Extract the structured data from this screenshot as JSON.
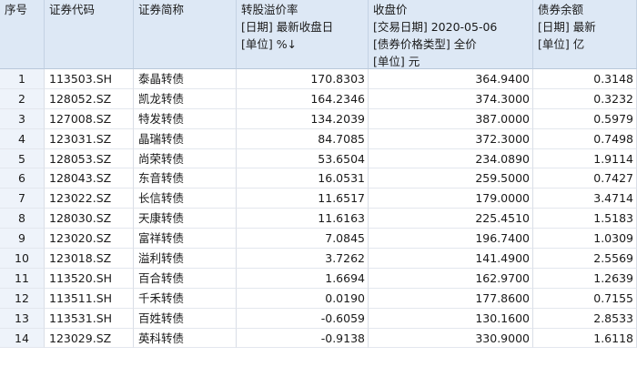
{
  "headers": [
    {
      "key": "idx",
      "lines": [
        "序号"
      ]
    },
    {
      "key": "code",
      "lines": [
        "证券代码"
      ]
    },
    {
      "key": "name",
      "lines": [
        "证券简称"
      ]
    },
    {
      "key": "premium",
      "lines": [
        "转股溢价率",
        "[日期] 最新收盘日",
        "[单位] %↓"
      ]
    },
    {
      "key": "close",
      "lines": [
        "收盘价",
        "[交易日期] 2020-05-06",
        "[债券价格类型] 全价",
        "[单位] 元"
      ]
    },
    {
      "key": "balance",
      "lines": [
        "债券余额",
        "[日期] 最新",
        "[单位] 亿"
      ]
    }
  ],
  "rows": [
    {
      "idx": "1",
      "code": "113503.SH",
      "name": "泰晶转债",
      "premium": "170.8303",
      "close": "364.9400",
      "balance": "0.3148"
    },
    {
      "idx": "2",
      "code": "128052.SZ",
      "name": "凯龙转债",
      "premium": "164.2346",
      "close": "374.3000",
      "balance": "0.3232"
    },
    {
      "idx": "3",
      "code": "127008.SZ",
      "name": "特发转债",
      "premium": "134.2039",
      "close": "387.0000",
      "balance": "0.5979"
    },
    {
      "idx": "4",
      "code": "123031.SZ",
      "name": "晶瑞转债",
      "premium": "84.7085",
      "close": "372.3000",
      "balance": "0.7498"
    },
    {
      "idx": "5",
      "code": "128053.SZ",
      "name": "尚荣转债",
      "premium": "53.6504",
      "close": "234.0890",
      "balance": "1.9114"
    },
    {
      "idx": "6",
      "code": "128043.SZ",
      "name": "东音转债",
      "premium": "16.0531",
      "close": "259.5000",
      "balance": "0.7427"
    },
    {
      "idx": "7",
      "code": "123022.SZ",
      "name": "长信转债",
      "premium": "11.6517",
      "close": "179.0000",
      "balance": "3.4714"
    },
    {
      "idx": "8",
      "code": "128030.SZ",
      "name": "天康转债",
      "premium": "11.6163",
      "close": "225.4510",
      "balance": "1.5183"
    },
    {
      "idx": "9",
      "code": "123020.SZ",
      "name": "富祥转债",
      "premium": "7.0845",
      "close": "196.7400",
      "balance": "1.0309"
    },
    {
      "idx": "10",
      "code": "123018.SZ",
      "name": "溢利转债",
      "premium": "3.7262",
      "close": "141.4900",
      "balance": "2.5569"
    },
    {
      "idx": "11",
      "code": "113520.SH",
      "name": "百合转债",
      "premium": "1.6694",
      "close": "162.9700",
      "balance": "1.2639"
    },
    {
      "idx": "12",
      "code": "113511.SH",
      "name": "千禾转债",
      "premium": "0.0190",
      "close": "177.8600",
      "balance": "0.7155"
    },
    {
      "idx": "13",
      "code": "113531.SH",
      "name": "百姓转债",
      "premium": "-0.6059",
      "close": "130.1600",
      "balance": "2.8533"
    },
    {
      "idx": "14",
      "code": "123029.SZ",
      "name": "英科转债",
      "premium": "-0.9138",
      "close": "330.9000",
      "balance": "1.6118"
    }
  ]
}
